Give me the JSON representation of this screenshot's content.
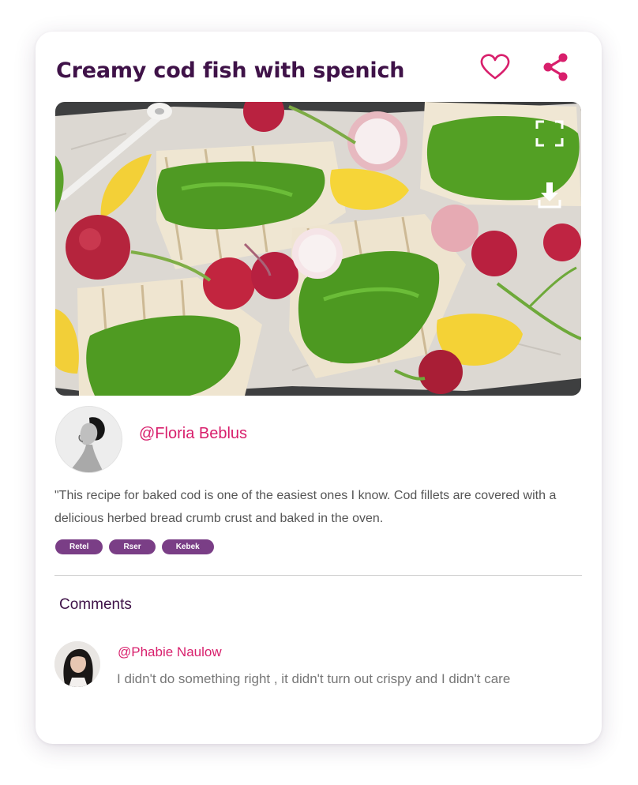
{
  "post": {
    "title": "Creamy cod fish with spenich",
    "author": "@Floria Beblus",
    "description": "\"This recipe for baked cod is one of the easiest ones I know. Cod fillets are covered with a delicious herbed bread crumb crust and baked in the oven.",
    "tags": [
      "Retel",
      "Rser",
      "Kebek"
    ]
  },
  "icons": {
    "like": "heart-icon",
    "share": "share-icon",
    "fullscreen": "fullscreen-icon",
    "download": "download-icon"
  },
  "comments": {
    "heading": "Comments",
    "items": [
      {
        "user": "@Phabie Naulow",
        "text": "I didn't do something right , it didn't turn out crispy and I didn't care"
      }
    ]
  },
  "colors": {
    "title": "#3f1248",
    "accent": "#d81f6c",
    "tag": "#7a3e86"
  }
}
